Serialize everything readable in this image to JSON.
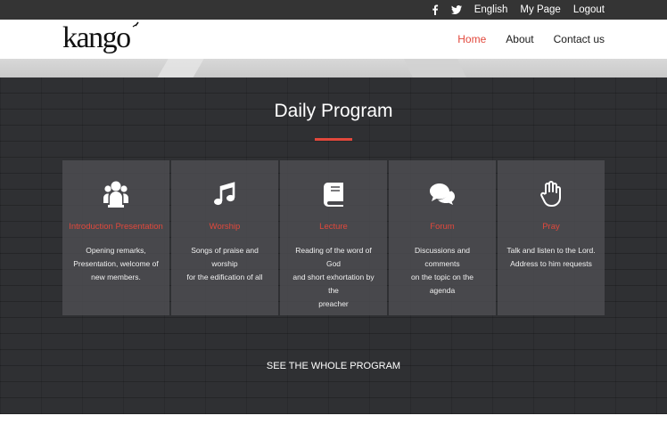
{
  "topbar": {
    "social": [
      {
        "icon": "facebook-icon"
      },
      {
        "icon": "twitter-icon"
      }
    ],
    "links": [
      {
        "label": "English"
      },
      {
        "label": "My Page"
      },
      {
        "label": "Logout"
      }
    ]
  },
  "header": {
    "logo_text": "kango",
    "nav": [
      {
        "label": "Home",
        "active": true
      },
      {
        "label": "About",
        "active": false
      },
      {
        "label": "Contact us",
        "active": false
      }
    ]
  },
  "section": {
    "title": "Daily Program",
    "accent_color": "#e2483c",
    "cards": [
      {
        "icon": "users-icon",
        "title": "Introduction Presentation",
        "desc": [
          "Opening remarks,",
          "Presentation, welcome of",
          "new members."
        ]
      },
      {
        "icon": "music-icon",
        "title": "Worship",
        "desc": [
          "Songs of praise and worship",
          "for the edification of all"
        ]
      },
      {
        "icon": "book-icon",
        "title": "Lecture",
        "desc": [
          "Reading of the word of God",
          "and short exhortation by the",
          "preacher"
        ]
      },
      {
        "icon": "comments-icon",
        "title": "Forum",
        "desc": [
          "Discussions and comments",
          "on the topic on the agenda"
        ]
      },
      {
        "icon": "hand-icon",
        "title": "Pray",
        "desc": [
          "Talk and listen to the Lord.",
          "Address to him requests"
        ]
      }
    ],
    "cta_label": "SEE THE WHOLE PROGRAM"
  }
}
